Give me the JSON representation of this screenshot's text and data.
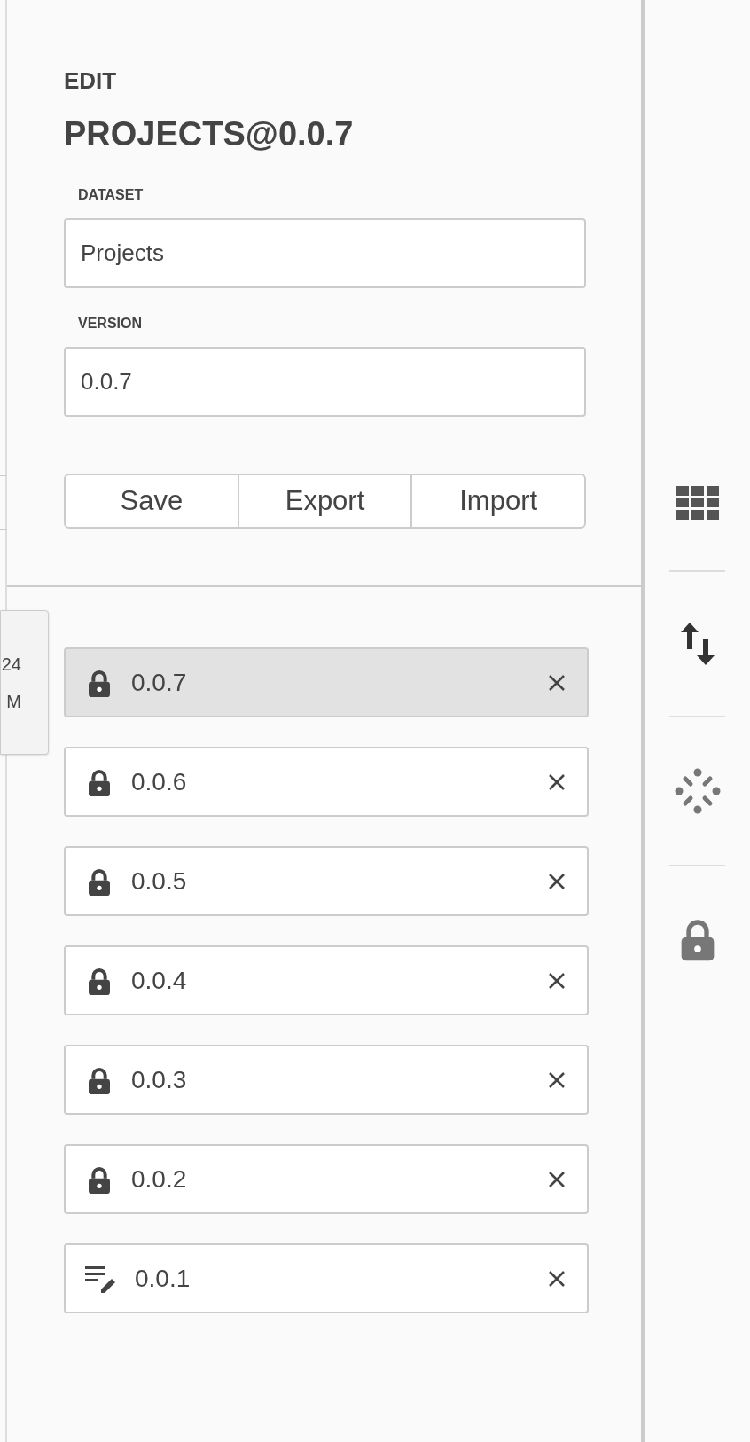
{
  "panel": {
    "heading": "EDIT",
    "title": "PROJECTS@0.0.7",
    "fields": [
      {
        "label": "DATASET",
        "value": "Projects"
      },
      {
        "label": "VERSION",
        "value": "0.0.7"
      }
    ],
    "buttons": [
      "Save",
      "Export",
      "Import"
    ]
  },
  "tooltip": {
    "lines": [
      "24",
      "M"
    ]
  },
  "versions": [
    {
      "label": "0.0.7",
      "kind": "locked",
      "selected": true
    },
    {
      "label": "0.0.6",
      "kind": "locked",
      "selected": false
    },
    {
      "label": "0.0.5",
      "kind": "locked",
      "selected": false
    },
    {
      "label": "0.0.4",
      "kind": "locked",
      "selected": false
    },
    {
      "label": "0.0.3",
      "kind": "locked",
      "selected": false
    },
    {
      "label": "0.0.2",
      "kind": "locked",
      "selected": false
    },
    {
      "label": "0.0.1",
      "kind": "draft",
      "selected": false
    }
  ],
  "rail": [
    {
      "kind": "grid"
    },
    {
      "kind": "sort"
    },
    {
      "kind": "spinner"
    },
    {
      "kind": "lock"
    }
  ]
}
